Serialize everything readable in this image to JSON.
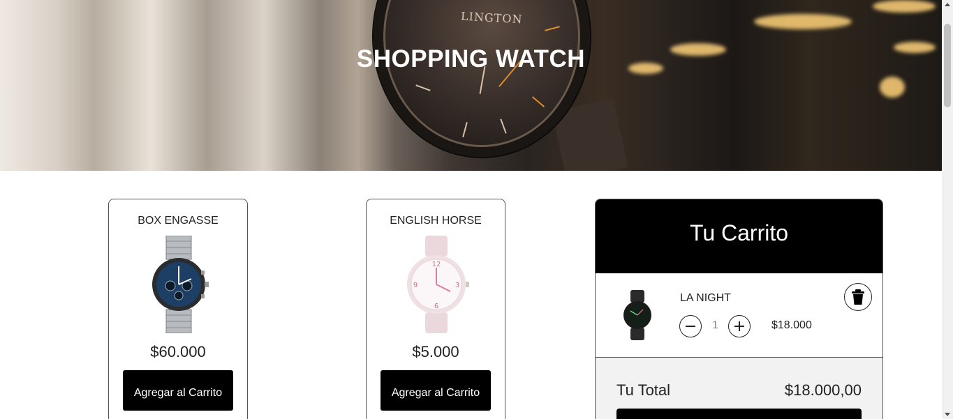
{
  "hero": {
    "title": "SHOPPING WATCH",
    "brand": "LINGTON"
  },
  "products": [
    {
      "name": "BOX ENGASSE",
      "price": "$60.000",
      "button_label": "Agregar al Carrito",
      "icon": "chronograph-watch-icon"
    },
    {
      "name": "ENGLISH HORSE",
      "price": "$5.000",
      "button_label": "Agregar al Carrito",
      "icon": "pink-watch-icon"
    }
  ],
  "cart": {
    "title": "Tu Carrito",
    "items": [
      {
        "name": "LA NIGHT",
        "quantity": "1",
        "price": "$18.000",
        "icon": "black-watch-icon"
      }
    ],
    "total_label": "Tu Total",
    "total_value": "$18.000,00"
  },
  "colors": {
    "primary": "#000000",
    "total_bg": "#f2f2f2",
    "text": "#222222"
  }
}
